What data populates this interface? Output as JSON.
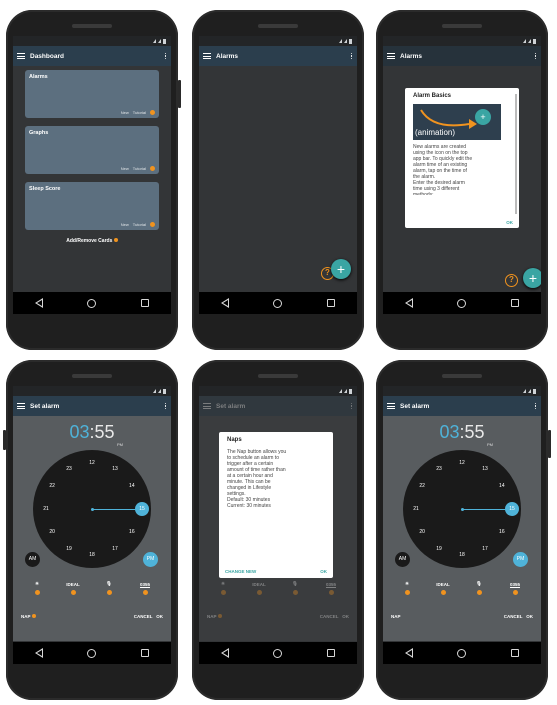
{
  "panels": [
    {
      "title": "Dashboard",
      "cards": [
        {
          "label": "Alarms",
          "new": "New",
          "tutorial": "Tutorial"
        },
        {
          "label": "Graphs",
          "new": "New",
          "tutorial": "Tutorial"
        },
        {
          "label": "Sleep Score",
          "new": "New",
          "tutorial": "Tutorial"
        }
      ],
      "add_remove": "Add/Remove Cards"
    },
    {
      "title": "Alarms",
      "help": "?",
      "fab": "+"
    },
    {
      "title": "Alarms",
      "dialog": {
        "title": "Alarm Basics",
        "animation": "(animation)",
        "lines": [
          "New alarms are created",
          "using the  icon on the top",
          "app bar. To quickly edit the",
          "alarm time of an existing",
          "alarm, tap on the time of",
          "the alarm.",
          "Enter the desired alarm",
          "time using 3 different",
          "methods:"
        ],
        "ok": "OK"
      },
      "help": "?",
      "fab": "+"
    },
    {
      "title": "Set alarm"
    },
    {
      "title": "Set alarm",
      "dialog": {
        "title": "Naps",
        "lines": [
          "The Nap button allows you",
          "to schedule an alarm to",
          "trigger after a certain",
          "amount of time rather than",
          "at a certain hour and",
          "minute. This can be",
          "changed in Lifestyle",
          "settings.",
          "Default: 30 minutes",
          "Current: 30 minutes"
        ],
        "change": "CHANGE NEW",
        "ok": "OK"
      }
    },
    {
      "title": "Set alarm"
    }
  ],
  "setalarm": {
    "hour": "03",
    "colon": ":",
    "minute": "55",
    "pm_small": "PM",
    "clock_numbers": [
      "12",
      "13",
      "14",
      "15",
      "16",
      "17",
      "18",
      "19",
      "20",
      "21",
      "22",
      "23"
    ],
    "am": "AM",
    "pm": "PM",
    "options": [
      "IDEAL",
      "0355"
    ],
    "nap": "NAP",
    "cancel": "CANCEL",
    "ok": "OK"
  },
  "colors": {
    "accent": "#3aa5a3",
    "orange": "#f0931f",
    "clock_blue": "#4fb3d9",
    "appbar": "#2b3e4d"
  }
}
